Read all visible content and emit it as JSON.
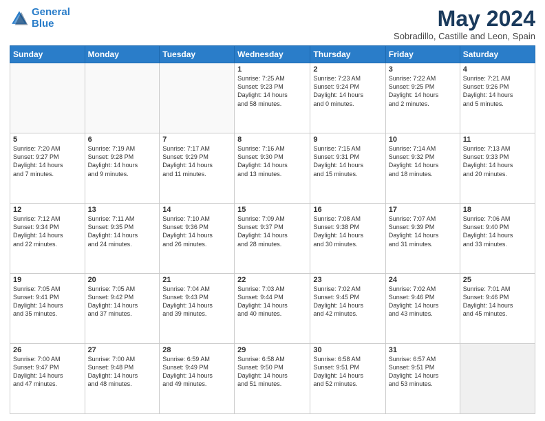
{
  "header": {
    "logo_line1": "General",
    "logo_line2": "Blue",
    "month": "May 2024",
    "location": "Sobradillo, Castille and Leon, Spain"
  },
  "weekdays": [
    "Sunday",
    "Monday",
    "Tuesday",
    "Wednesday",
    "Thursday",
    "Friday",
    "Saturday"
  ],
  "weeks": [
    [
      {
        "day": "",
        "info": ""
      },
      {
        "day": "",
        "info": ""
      },
      {
        "day": "",
        "info": ""
      },
      {
        "day": "1",
        "info": "Sunrise: 7:25 AM\nSunset: 9:23 PM\nDaylight: 14 hours\nand 58 minutes."
      },
      {
        "day": "2",
        "info": "Sunrise: 7:23 AM\nSunset: 9:24 PM\nDaylight: 14 hours\nand 0 minutes."
      },
      {
        "day": "3",
        "info": "Sunrise: 7:22 AM\nSunset: 9:25 PM\nDaylight: 14 hours\nand 2 minutes."
      },
      {
        "day": "4",
        "info": "Sunrise: 7:21 AM\nSunset: 9:26 PM\nDaylight: 14 hours\nand 5 minutes."
      }
    ],
    [
      {
        "day": "5",
        "info": "Sunrise: 7:20 AM\nSunset: 9:27 PM\nDaylight: 14 hours\nand 7 minutes."
      },
      {
        "day": "6",
        "info": "Sunrise: 7:19 AM\nSunset: 9:28 PM\nDaylight: 14 hours\nand 9 minutes."
      },
      {
        "day": "7",
        "info": "Sunrise: 7:17 AM\nSunset: 9:29 PM\nDaylight: 14 hours\nand 11 minutes."
      },
      {
        "day": "8",
        "info": "Sunrise: 7:16 AM\nSunset: 9:30 PM\nDaylight: 14 hours\nand 13 minutes."
      },
      {
        "day": "9",
        "info": "Sunrise: 7:15 AM\nSunset: 9:31 PM\nDaylight: 14 hours\nand 15 minutes."
      },
      {
        "day": "10",
        "info": "Sunrise: 7:14 AM\nSunset: 9:32 PM\nDaylight: 14 hours\nand 18 minutes."
      },
      {
        "day": "11",
        "info": "Sunrise: 7:13 AM\nSunset: 9:33 PM\nDaylight: 14 hours\nand 20 minutes."
      }
    ],
    [
      {
        "day": "12",
        "info": "Sunrise: 7:12 AM\nSunset: 9:34 PM\nDaylight: 14 hours\nand 22 minutes."
      },
      {
        "day": "13",
        "info": "Sunrise: 7:11 AM\nSunset: 9:35 PM\nDaylight: 14 hours\nand 24 minutes."
      },
      {
        "day": "14",
        "info": "Sunrise: 7:10 AM\nSunset: 9:36 PM\nDaylight: 14 hours\nand 26 minutes."
      },
      {
        "day": "15",
        "info": "Sunrise: 7:09 AM\nSunset: 9:37 PM\nDaylight: 14 hours\nand 28 minutes."
      },
      {
        "day": "16",
        "info": "Sunrise: 7:08 AM\nSunset: 9:38 PM\nDaylight: 14 hours\nand 30 minutes."
      },
      {
        "day": "17",
        "info": "Sunrise: 7:07 AM\nSunset: 9:39 PM\nDaylight: 14 hours\nand 31 minutes."
      },
      {
        "day": "18",
        "info": "Sunrise: 7:06 AM\nSunset: 9:40 PM\nDaylight: 14 hours\nand 33 minutes."
      }
    ],
    [
      {
        "day": "19",
        "info": "Sunrise: 7:05 AM\nSunset: 9:41 PM\nDaylight: 14 hours\nand 35 minutes."
      },
      {
        "day": "20",
        "info": "Sunrise: 7:05 AM\nSunset: 9:42 PM\nDaylight: 14 hours\nand 37 minutes."
      },
      {
        "day": "21",
        "info": "Sunrise: 7:04 AM\nSunset: 9:43 PM\nDaylight: 14 hours\nand 39 minutes."
      },
      {
        "day": "22",
        "info": "Sunrise: 7:03 AM\nSunset: 9:44 PM\nDaylight: 14 hours\nand 40 minutes."
      },
      {
        "day": "23",
        "info": "Sunrise: 7:02 AM\nSunset: 9:45 PM\nDaylight: 14 hours\nand 42 minutes."
      },
      {
        "day": "24",
        "info": "Sunrise: 7:02 AM\nSunset: 9:46 PM\nDaylight: 14 hours\nand 43 minutes."
      },
      {
        "day": "25",
        "info": "Sunrise: 7:01 AM\nSunset: 9:46 PM\nDaylight: 14 hours\nand 45 minutes."
      }
    ],
    [
      {
        "day": "26",
        "info": "Sunrise: 7:00 AM\nSunset: 9:47 PM\nDaylight: 14 hours\nand 47 minutes."
      },
      {
        "day": "27",
        "info": "Sunrise: 7:00 AM\nSunset: 9:48 PM\nDaylight: 14 hours\nand 48 minutes."
      },
      {
        "day": "28",
        "info": "Sunrise: 6:59 AM\nSunset: 9:49 PM\nDaylight: 14 hours\nand 49 minutes."
      },
      {
        "day": "29",
        "info": "Sunrise: 6:58 AM\nSunset: 9:50 PM\nDaylight: 14 hours\nand 51 minutes."
      },
      {
        "day": "30",
        "info": "Sunrise: 6:58 AM\nSunset: 9:51 PM\nDaylight: 14 hours\nand 52 minutes."
      },
      {
        "day": "31",
        "info": "Sunrise: 6:57 AM\nSunset: 9:51 PM\nDaylight: 14 hours\nand 53 minutes."
      },
      {
        "day": "",
        "info": ""
      }
    ]
  ]
}
